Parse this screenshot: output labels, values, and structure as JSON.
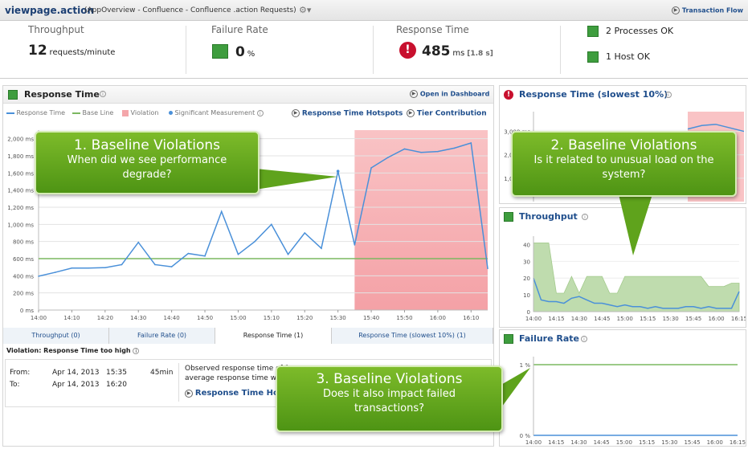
{
  "header": {
    "title": "viewpage.action",
    "subtitle": "(AppOverview - Confluence - Confluence .action Requests)",
    "gear": "gear-icon",
    "flow_link": "Transaction Flow"
  },
  "kpi": {
    "throughput": {
      "label": "Throughput",
      "value": "12",
      "unit": "requests/minute"
    },
    "failure": {
      "label": "Failure Rate",
      "value": "0",
      "unit": "%"
    },
    "response": {
      "label": "Response Time",
      "value": "485",
      "unit": "ms",
      "extra": "[1.8 s]"
    },
    "processes": "2 Processes OK",
    "hosts": "1 Host OK"
  },
  "main": {
    "title": "Response Time",
    "open": "Open in Dashboard",
    "legend": {
      "rt": "Response Time",
      "bl": "Base Line",
      "vi": "Violation",
      "sm": "Significant Measurement"
    },
    "hotspots": "Response Time Hotspots",
    "tier": "Tier Contribution"
  },
  "tabs": [
    "Throughput (0)",
    "Failure Rate (0)",
    "Response Time (1)",
    "Response Time (slowest 10%) (1)"
  ],
  "violation": {
    "title": "Violation: Response Time too high",
    "from_label": "From:",
    "to_label": "To:",
    "from_date": "Apr 14, 2013",
    "from_time": "15:35",
    "to_date": "Apr 14, 2013",
    "to_time": "16:20",
    "duration": "45min",
    "text1": "Observed response time of 1",
    "text2": "average response time was",
    "link": "Response Time Hot"
  },
  "right": {
    "slowest_title": "Response Time (slowest 10%)",
    "throughput_title": "Throughput",
    "failure_title": "Failure Rate"
  },
  "callouts": [
    {
      "h": "1. Baseline Violations",
      "b": "When did we see performance degrade?"
    },
    {
      "h": "2. Baseline Violations",
      "b": "Is it related to unusual load on the system?"
    },
    {
      "h": "3. Baseline Violations",
      "b": "Does it also impact failed transactions?"
    }
  ],
  "colors": {
    "accent": "#1f4e8c",
    "ok": "#3e9d3e",
    "error": "#c8102e",
    "line": "#4a90d9",
    "baseline": "#7cb860",
    "violation": "#f4a6aa"
  },
  "chart_data": [
    {
      "type": "line",
      "title": "Response Time",
      "x": [
        "14:00",
        "14:05",
        "14:10",
        "14:15",
        "14:20",
        "14:25",
        "14:30",
        "14:35",
        "14:40",
        "14:45",
        "14:50",
        "14:55",
        "15:00",
        "15:05",
        "15:10",
        "15:15",
        "15:20",
        "15:25",
        "15:30",
        "15:35",
        "15:40",
        "15:45",
        "15:50",
        "15:55",
        "16:00",
        "16:05",
        "16:10",
        "16:15"
      ],
      "xticks": [
        "14:00",
        "14:10",
        "14:20",
        "14:30",
        "14:40",
        "14:50",
        "15:00",
        "15:10",
        "15:20",
        "15:30",
        "15:40",
        "15:50",
        "16:00",
        "16:10"
      ],
      "series": [
        {
          "name": "Response Time",
          "values": [
            395,
            440,
            490,
            490,
            495,
            530,
            790,
            530,
            505,
            660,
            630,
            1150,
            650,
            800,
            1000,
            650,
            900,
            720,
            1620,
            760,
            1660,
            1780,
            1880,
            1840,
            1850,
            1890,
            1950,
            485
          ]
        },
        {
          "name": "Base Line",
          "values": [
            600,
            600,
            600,
            600,
            600,
            600,
            600,
            600,
            600,
            600,
            600,
            600,
            600,
            600,
            600,
            600,
            600,
            600,
            600,
            600,
            600,
            600,
            600,
            600,
            600,
            600,
            600,
            600
          ]
        }
      ],
      "violation_from": "15:35",
      "violation_to": "16:15",
      "yticks": [
        "0 ms",
        "200 ms",
        "400 ms",
        "600 ms",
        "800 ms",
        "1,000 ms",
        "1,200 ms",
        "1,400 ms",
        "1,600 ms",
        "1,800 ms",
        "2,000 ms"
      ],
      "ylim": [
        0,
        2100
      ]
    },
    {
      "type": "line",
      "title": "Response Time (slowest 10%)",
      "yticks": [
        "1,000 ms",
        "2,000 ms",
        "3,000 ms"
      ],
      "series": [
        {
          "name": "Response Time",
          "values": [
            3100,
            3250,
            3300,
            3150,
            3000
          ]
        }
      ]
    },
    {
      "type": "area",
      "title": "Throughput",
      "x": [
        "14:00",
        "14:05",
        "14:10",
        "14:15",
        "14:20",
        "14:25",
        "14:30",
        "14:35",
        "14:40",
        "14:45",
        "14:50",
        "14:55",
        "15:00",
        "15:05",
        "15:10",
        "15:15",
        "15:20",
        "15:25",
        "15:30",
        "15:35",
        "15:40",
        "15:45",
        "15:50",
        "15:55",
        "16:00",
        "16:05",
        "16:10",
        "16:15"
      ],
      "xticks": [
        "14:00",
        "14:15",
        "14:30",
        "14:45",
        "15:00",
        "15:15",
        "15:30",
        "15:45",
        "16:00",
        "16:15"
      ],
      "series": [
        {
          "name": "Response Time",
          "values": [
            20,
            7,
            6,
            6,
            5,
            8,
            9,
            7,
            5,
            5,
            4,
            3,
            4,
            3,
            3,
            2,
            3,
            2,
            2,
            2,
            3,
            3,
            2,
            3,
            2,
            2,
            2,
            12
          ]
        },
        {
          "name": "Base Line",
          "values": [
            41,
            41,
            41,
            11,
            11,
            21,
            11,
            21,
            21,
            21,
            11,
            11,
            21,
            21,
            21,
            21,
            21,
            21,
            21,
            21,
            21,
            21,
            21,
            15,
            15,
            15,
            17,
            17
          ]
        }
      ],
      "yticks": [
        "0",
        "10",
        "20",
        "30",
        "40"
      ],
      "ylim": [
        0,
        45
      ]
    },
    {
      "type": "line",
      "title": "Failure Rate",
      "x": [
        "14:00",
        "14:15",
        "14:30",
        "14:45",
        "15:00",
        "15:15",
        "15:30",
        "15:45",
        "16:00",
        "16:15"
      ],
      "yticks": [
        "0 %",
        "1 %"
      ],
      "series": [
        {
          "name": "Failure Rate",
          "values": [
            0,
            0,
            0,
            0,
            0,
            0,
            0,
            0,
            0,
            0
          ]
        },
        {
          "name": "Base Line",
          "values": [
            1,
            1,
            1,
            1,
            1,
            1,
            1,
            1,
            1,
            1
          ]
        }
      ]
    }
  ]
}
